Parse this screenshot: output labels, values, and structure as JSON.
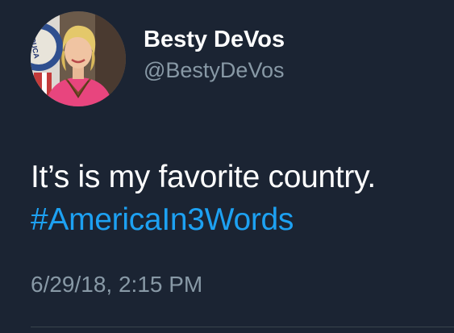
{
  "tweet": {
    "display_name": "Besty DeVos",
    "handle": "@BestyDeVos",
    "text": "It’s is my favorite country.",
    "hashtag": "#AmericaIn3Words",
    "timestamp": "6/29/18, 2:15 PM",
    "avatar_seal_text": "EDUCA"
  },
  "colors": {
    "background": "#1b2433",
    "hashtag": "#1da1f2",
    "secondary_text": "#8899a6",
    "primary_text": "#ffffff"
  }
}
